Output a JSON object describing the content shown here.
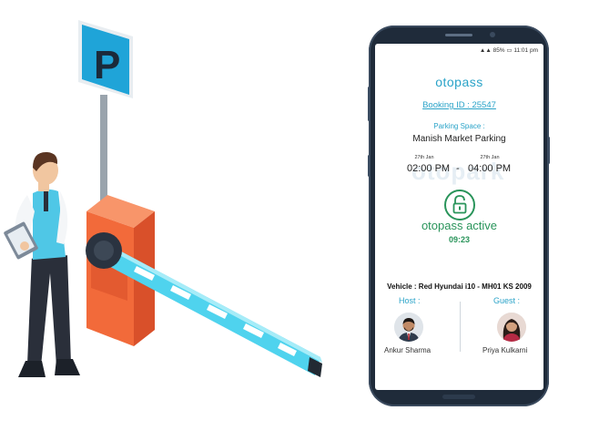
{
  "status_bar": {
    "battery": "85%",
    "time": "11:01 pm"
  },
  "app": {
    "brand": "otopass",
    "watermark": "otopark"
  },
  "booking": {
    "id_label": "Booking ID : 25547"
  },
  "parking": {
    "space_label": "Parking Space :",
    "name": "Manish Market Parking"
  },
  "schedule": {
    "start_date": "27th Jan",
    "end_date": "27th Jan",
    "start_time": "02:00 PM",
    "separator": "-",
    "end_time": "04:00 PM"
  },
  "status": {
    "label": "otopass active",
    "countdown": "09:23"
  },
  "vehicle": {
    "label": "Vehicle : Red Hyundai i10 - MH01 KS 2009"
  },
  "host": {
    "role": "Host :",
    "name": "Ankur Sharma"
  },
  "guest": {
    "role": "Guest :",
    "name": "Priya Kulkarni"
  },
  "illustration": {
    "sign_letter": "P"
  },
  "colors": {
    "accent": "#2aa3c8",
    "active": "#29945a",
    "barrier": "#f26a3a",
    "boom": "#4fd3ee"
  }
}
